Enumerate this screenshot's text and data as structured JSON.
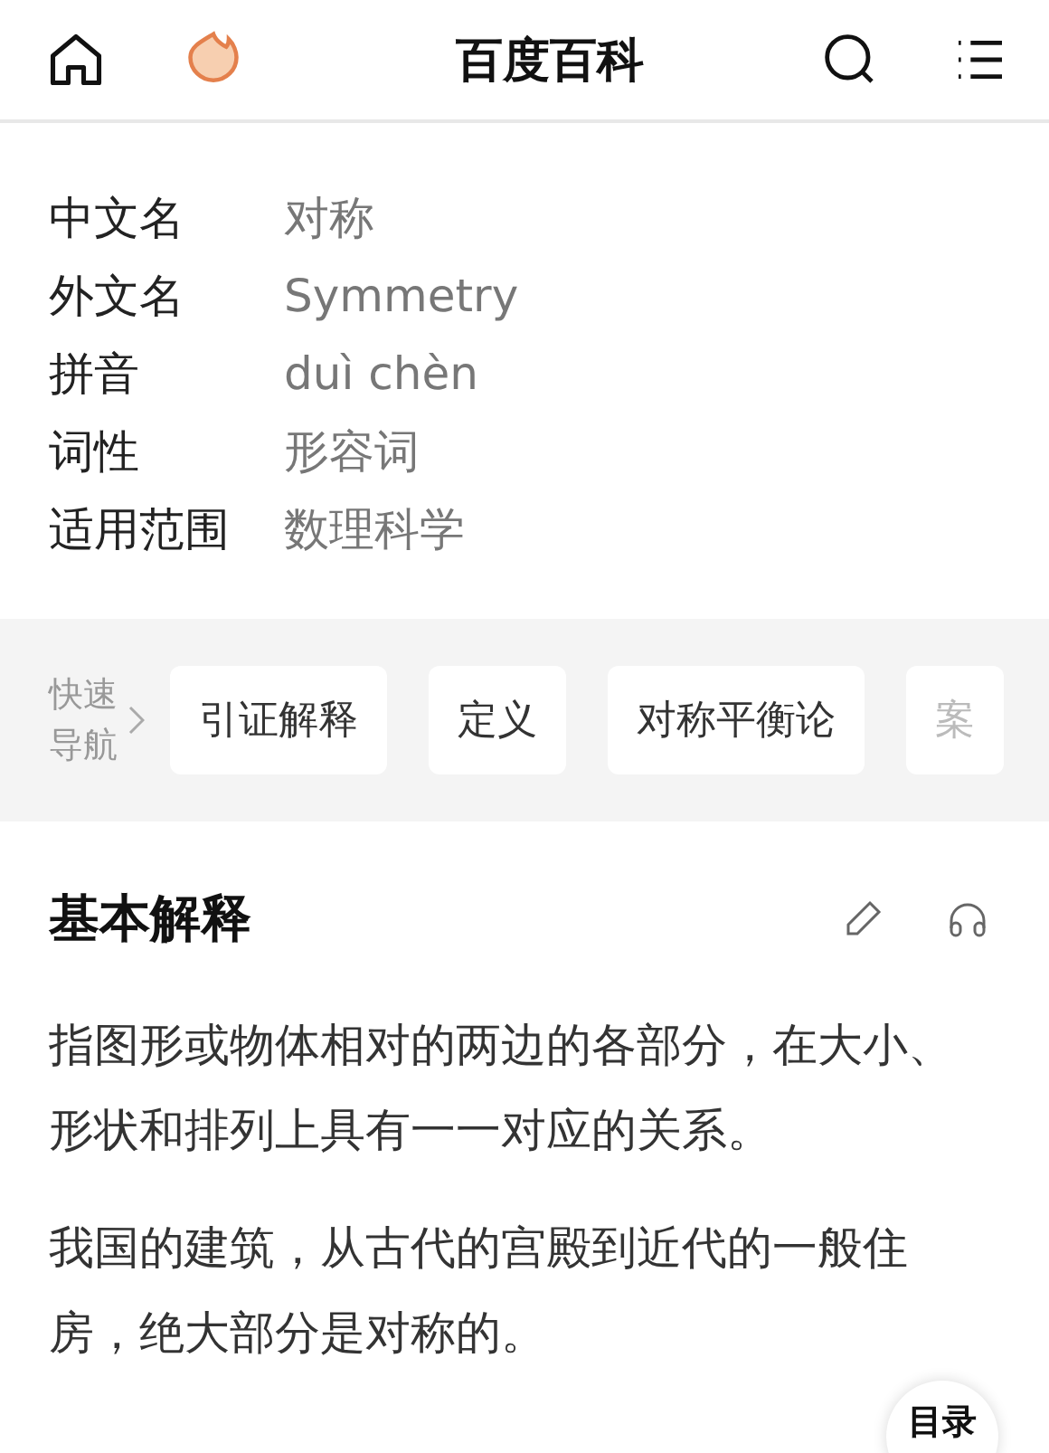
{
  "header": {
    "title": "百度百科"
  },
  "info": [
    {
      "label": "中文名",
      "value": "对称"
    },
    {
      "label": "外文名",
      "value": "Symmetry"
    },
    {
      "label": "拼音",
      "value": "duì chèn"
    },
    {
      "label": "词性",
      "value": "形容词"
    },
    {
      "label": "适用范围",
      "value": "数理科学"
    }
  ],
  "quick_nav": {
    "label_lines": [
      "快速",
      "导航"
    ],
    "items": [
      "引证解释",
      "定义",
      "对称平衡论",
      "案"
    ]
  },
  "section": {
    "title": "基本解释",
    "paragraphs": [
      "指图形或物体相对的两边的各部分，在大小、形状和排列上具有一一对应的关系。",
      "我国的建筑，从古代的宫殿到近代的一般住房，绝大部分是对称的。"
    ]
  },
  "toc_button": "目录"
}
